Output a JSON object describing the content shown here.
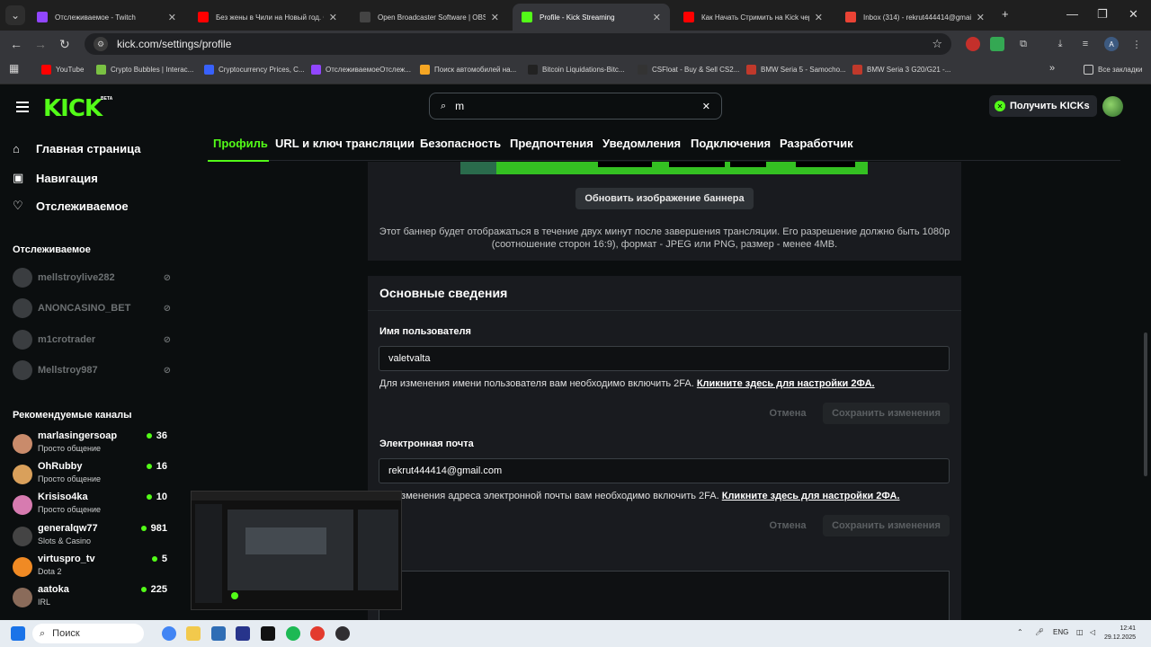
{
  "browser": {
    "tabs": [
      {
        "title": "Отслеживаемое - Twitch",
        "color": "#9146ff"
      },
      {
        "title": "Без жены в Чили на Новый год. С",
        "color": "#ff0000"
      },
      {
        "title": "Open Broadcaster Software | OBS",
        "color": "#444444"
      },
      {
        "title": "Profile - Kick Streaming",
        "color": "#53fc18"
      },
      {
        "title": "Как Начать Стримить на Kick чере",
        "color": "#ff0000"
      },
      {
        "title": "Inbox (314) - rekrut444414@gmail.c",
        "color": "#ea4335"
      }
    ],
    "new_tab": "+",
    "url": "kick.com/settings/profile",
    "bookmarks": [
      {
        "label": "YouTube",
        "color": "#ff0000"
      },
      {
        "label": "Crypto Bubbles | Interac...",
        "color": "#7ac143"
      },
      {
        "label": "Cryptocurrency Prices, C...",
        "color": "#3861fb"
      },
      {
        "label": "ОтслеживаемоеОтслеж...",
        "color": "#9146ff"
      },
      {
        "label": "Поиск автомобилей на...",
        "color": "#f5a623"
      },
      {
        "label": "Bitcoin Liquidations-Bitc...",
        "color": "#222222"
      },
      {
        "label": "CSFloat - Buy & Sell CS2...",
        "color": "#333333"
      },
      {
        "label": "BMW Seria 5 - Samocho...",
        "color": "#c0392b"
      },
      {
        "label": "BMW Seria 3 G20/G21 -...",
        "color": "#c0392b"
      }
    ],
    "all_bookmarks": "Все закладки"
  },
  "header": {
    "logo": "KICK",
    "beta": "BETA",
    "search_value": "m",
    "kicks_button": "Получить KICKs"
  },
  "sidebar": {
    "main": [
      {
        "label": "Главная страница",
        "icon": "home-icon"
      },
      {
        "label": "Навигация",
        "icon": "compass-icon"
      },
      {
        "label": "Отслеживаемое",
        "icon": "heart-icon"
      }
    ],
    "following_title": "Отслеживаемое",
    "following": [
      {
        "name": "mellstroylive282"
      },
      {
        "name": "ANONCASINO_BET"
      },
      {
        "name": "m1crotrader"
      },
      {
        "name": "Mellstroy987"
      }
    ],
    "recommended_title": "Рекомендуемые каналы",
    "recommended": [
      {
        "name": "marlasingersoap",
        "category": "Просто общение",
        "viewers": "36",
        "color": "#c98b6b"
      },
      {
        "name": "OhRubby",
        "category": "Просто общение",
        "viewers": "16",
        "color": "#d9a05b"
      },
      {
        "name": "Krisiso4ka",
        "category": "Просто общение",
        "viewers": "10",
        "color": "#d77bb0"
      },
      {
        "name": "generalqw77",
        "category": "Slots & Casino",
        "viewers": "981",
        "color": "#444444"
      },
      {
        "name": "virtuspro_tv",
        "category": "Dota 2",
        "viewers": "5",
        "color": "#f08a24"
      },
      {
        "name": "aatoka",
        "category": "IRL",
        "viewers": "225",
        "color": "#8a6b5a"
      }
    ]
  },
  "settings_tabs": [
    "Профиль",
    "URL и ключ трансляции",
    "Безопасность",
    "Предпочтения",
    "Уведомления",
    "Подключения",
    "Разработчик"
  ],
  "banner": {
    "update_button": "Обновить изображение баннера",
    "hint": "Этот баннер будет отображаться в течение двух минут после завершения трансляции. Его разрешение должно быть 1080p (соотношение сторон 16:9), формат - JPEG или PNG, размер - менее 4MB."
  },
  "basic": {
    "title": "Основные сведения",
    "username_label": "Имя пользователя",
    "username_value": "valetvalta",
    "username_note": "Для изменения имени пользователя вам необходимо включить 2FA.",
    "username_link": "Кликните здесь для настройки 2ФА.",
    "cancel": "Отмена",
    "save": "Сохранить изменения",
    "email_label": "Электронная почта",
    "email_value": "rekrut444414@gmail.com",
    "email_note": "изменения адреса электронной почты вам необходимо включить 2FA.",
    "email_link": "Кликните здесь для настройки 2ФА."
  },
  "taskbar": {
    "search": "Поиск",
    "lang": "ENG",
    "time": "12:41",
    "date": "29.12.2025"
  }
}
